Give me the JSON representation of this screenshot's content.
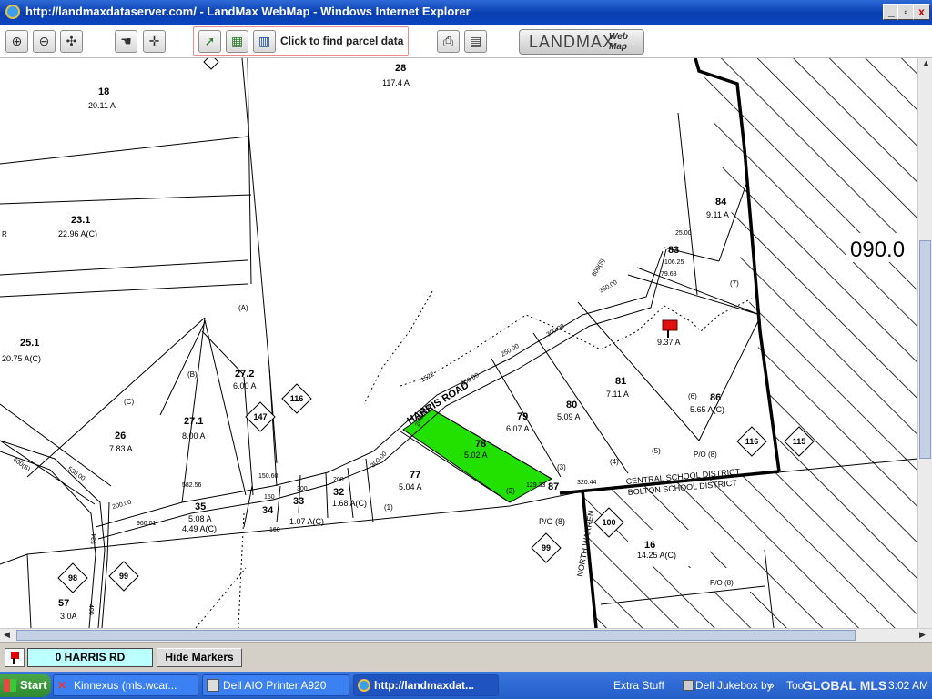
{
  "window": {
    "title": "http://landmaxdataserver.com/ - LandMax WebMap - Windows Internet Explorer",
    "controls": [
      "_",
      "▫",
      "x"
    ]
  },
  "toolbar": {
    "find_parcel_label": "Click to find parcel data",
    "logo_main": "LANDMAX",
    "logo_sub1": "Web",
    "logo_sub2": "Map"
  },
  "map": {
    "section_number": "090.0",
    "road_labels": {
      "harris_road": "HARRIS ROAD",
      "north_warren": "NORTH WARREN"
    },
    "district_labels": {
      "central": "CENTRAL SCHOOL DISTRICT",
      "bolton": "BOLTON SCHOOL DISTRICT"
    },
    "parcels": [
      {
        "id": "18",
        "area": "20.11 A"
      },
      {
        "id": "28",
        "area": "117.4 A"
      },
      {
        "id": "23.1",
        "area": "22.96 A(C)"
      },
      {
        "id": "25.1",
        "area": "20.75 A(C)"
      },
      {
        "id": "27.2",
        "area": "6.00 A"
      },
      {
        "id": "27.1",
        "area": "8.00 A"
      },
      {
        "id": "26",
        "area": "7.83 A"
      },
      {
        "id": "35",
        "area": "5.08 A"
      },
      {
        "id": "",
        "area": "4.49 A(C)"
      },
      {
        "id": "34",
        "area": ""
      },
      {
        "id": "33",
        "area": "1.07 A(C)"
      },
      {
        "id": "32",
        "area": "1.68 A(C)"
      },
      {
        "id": "77",
        "area": "5.04 A"
      },
      {
        "id": "78",
        "area": "5.02 A"
      },
      {
        "id": "79",
        "area": "6.07 A"
      },
      {
        "id": "80",
        "area": "5.09 A"
      },
      {
        "id": "81",
        "area": "7.11 A"
      },
      {
        "id": "",
        "area": "9.37 A"
      },
      {
        "id": "84",
        "area": "9.11 A"
      },
      {
        "id": "83",
        "area": ""
      },
      {
        "id": "86",
        "area": "5.65 A(C)"
      },
      {
        "id": "87",
        "area": "P/O (8)"
      },
      {
        "id": "16",
        "area": "14.25 A(C)"
      },
      {
        "id": "57",
        "area": "3.0A"
      }
    ],
    "route_markers": [
      "116",
      "147",
      "116",
      "115",
      "100",
      "99",
      "98",
      "99"
    ],
    "dimensions": [
      "25.00",
      "106.25",
      "79.68",
      "350.00",
      "300.00",
      "250.00",
      "300.00",
      "300.00",
      "200.00",
      "129.33",
      "320.44",
      "150.60",
      "582.56",
      "530.00",
      "200.00",
      "960.01",
      "300.00",
      "200",
      "300",
      "160",
      "150",
      "1522",
      "600(S)",
      "800(S)",
      "400",
      "1.534"
    ],
    "lot_letters": [
      "(A)",
      "(B)",
      "(C)",
      "(1)",
      "(2)",
      "(3)",
      "(4)",
      "(5)",
      "(6)",
      "(7)",
      "P/O (8)",
      "P/O (8)",
      "P/O (8)",
      "R"
    ]
  },
  "status": {
    "parcel_value": "0 HARRIS RD",
    "hide_markers_label": "Hide Markers"
  },
  "taskbar": {
    "start_label": "Start",
    "tasks": [
      {
        "label": "Kinnexus (mls.wcar..."
      },
      {
        "label": "Dell AIO Printer A920"
      },
      {
        "label": "http://landmaxdat..."
      }
    ],
    "tray": {
      "extra_stuff": "Extra Stuff",
      "dell_jukebox": "Dell Jukebox by",
      "chevron": "»",
      "tools": "Too",
      "watermark": "GLOBAL MLS",
      "time": "3:02 AM"
    }
  },
  "colors": {
    "highlight_parcel": "#22e000",
    "marker": "#e01010",
    "status_box": "#bbffff"
  }
}
